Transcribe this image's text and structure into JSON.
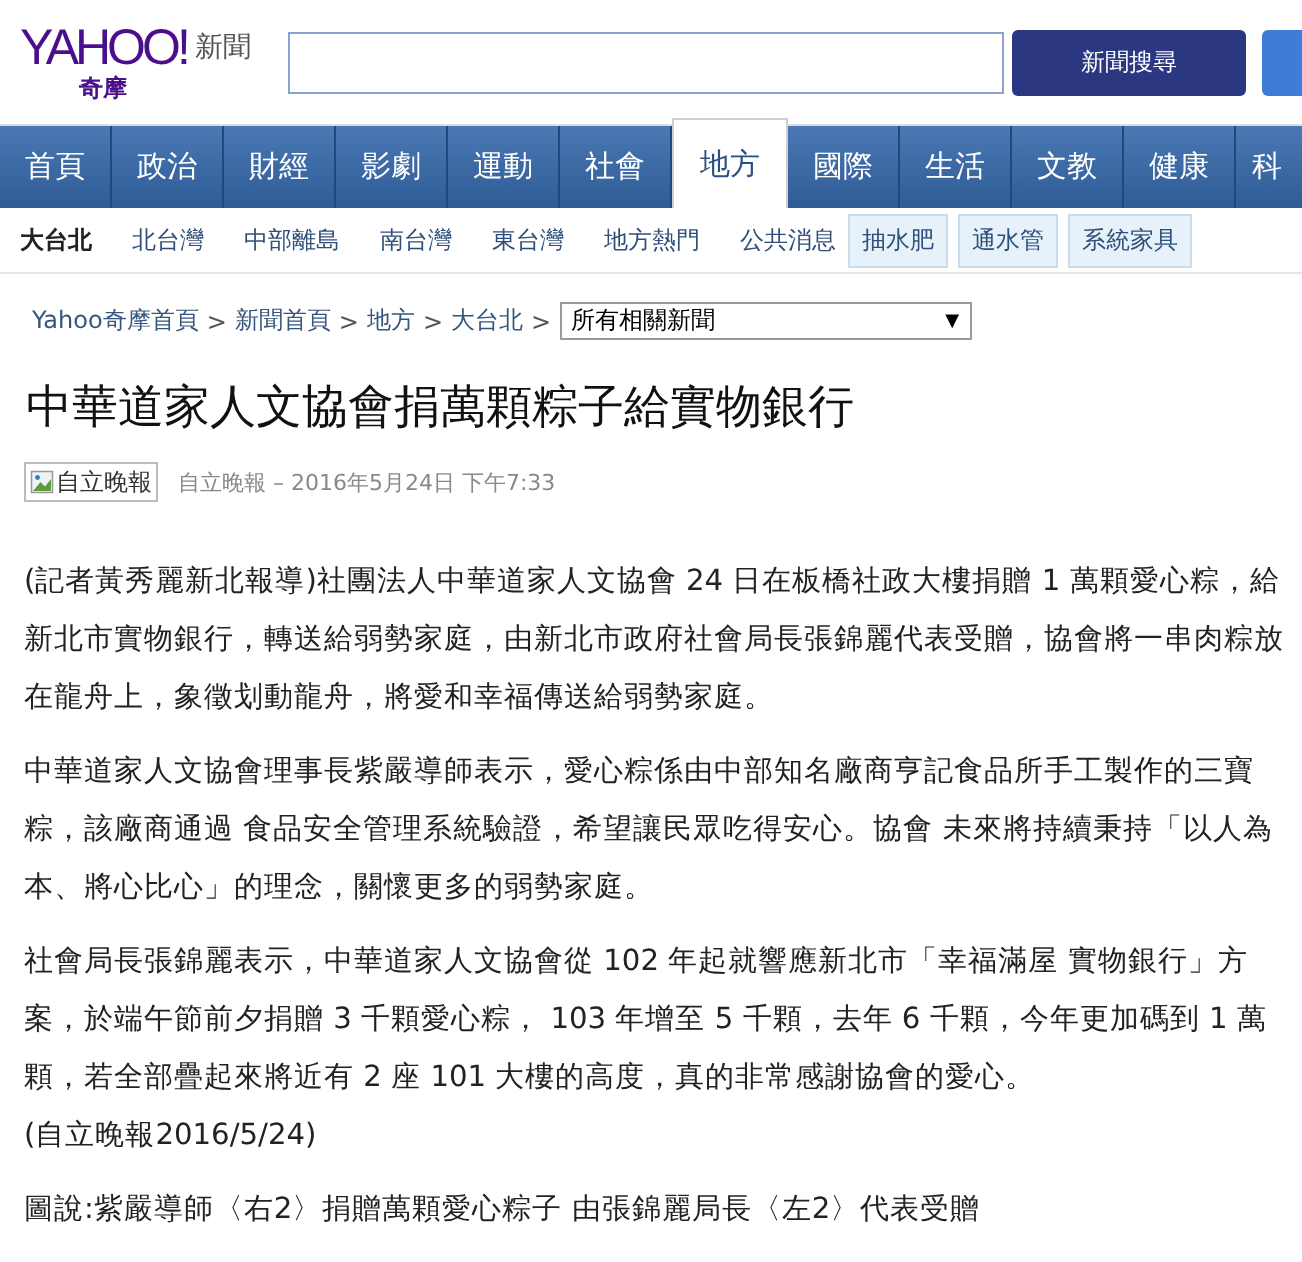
{
  "header": {
    "logo": "YAHOO!",
    "logo_sub": "奇摩",
    "section": "新聞",
    "search_button": "新聞搜尋"
  },
  "nav": [
    {
      "label": "首頁",
      "selected": false
    },
    {
      "label": "政治",
      "selected": false
    },
    {
      "label": "財經",
      "selected": false
    },
    {
      "label": "影劇",
      "selected": false
    },
    {
      "label": "運動",
      "selected": false
    },
    {
      "label": "社會",
      "selected": false
    },
    {
      "label": "地方",
      "selected": true
    },
    {
      "label": "國際",
      "selected": false
    },
    {
      "label": "生活",
      "selected": false
    },
    {
      "label": "文教",
      "selected": false
    },
    {
      "label": "健康",
      "selected": false
    },
    {
      "label": "科",
      "selected": false
    }
  ],
  "subnav": [
    {
      "label": "大台北",
      "kind": "link",
      "selected": true
    },
    {
      "label": "北台灣",
      "kind": "link",
      "selected": false
    },
    {
      "label": "中部離島",
      "kind": "link",
      "selected": false
    },
    {
      "label": "南台灣",
      "kind": "link",
      "selected": false
    },
    {
      "label": "東台灣",
      "kind": "link",
      "selected": false
    },
    {
      "label": "地方熱門",
      "kind": "link",
      "selected": false
    },
    {
      "label": "公共消息",
      "kind": "link",
      "selected": false
    },
    {
      "label": "抽水肥",
      "kind": "tag",
      "selected": false
    },
    {
      "label": "通水管",
      "kind": "tag",
      "selected": false
    },
    {
      "label": "系統家具",
      "kind": "tag",
      "selected": false
    }
  ],
  "breadcrumb": [
    "Yahoo奇摩首頁",
    "新聞首頁",
    "地方",
    "大台北"
  ],
  "breadcrumb_separator": ">",
  "related_select": {
    "value": "所有相關新聞",
    "arrow": "▼"
  },
  "article": {
    "title": "中華道家人文協會捐萬顆粽子給實物銀行",
    "source_logo_alt": "自立晚報",
    "byline": "自立晚報 – 2016年5月24日 下午7:33",
    "paragraphs": [
      "(記者黃秀麗新北報導)社團法人中華道家人文協會 24 日在板橋社政大樓捐贈 1 萬顆愛心粽，給新北市實物銀行，轉送給弱勢家庭，由新北市政府社會局長張錦麗代表受贈，協會將一串肉粽放在龍舟上，象徵划動龍舟，將愛和幸福傳送給弱勢家庭。",
      "中華道家人文協會理事長紫嚴導師表示，愛心粽係由中部知名廠商亨記食品所手工製作的三寶粽，該廠商通過 食品安全管理系統驗證，希望讓民眾吃得安心。協會 未來將持續秉持「以人為本、將心比心」的理念，關懷更多的弱勢家庭。",
      "社會局長張錦麗表示，中華道家人文協會從 102 年起就響應新北市「幸福滿屋 實物銀行」方案，於端午節前夕捐贈 3 千顆愛心粽， 103 年增至 5 千顆，去年 6 千顆，今年更加碼到 1 萬顆，若全部疊起來將近有 2 座 101 大樓的高度，真的非常感謝協會的愛心。\n(自立晚報2016/5/24)",
      "圖說:紫嚴導師〈右2〉捐贈萬顆愛心粽子 由張錦麗局長〈左2〉代表受贈"
    ]
  }
}
